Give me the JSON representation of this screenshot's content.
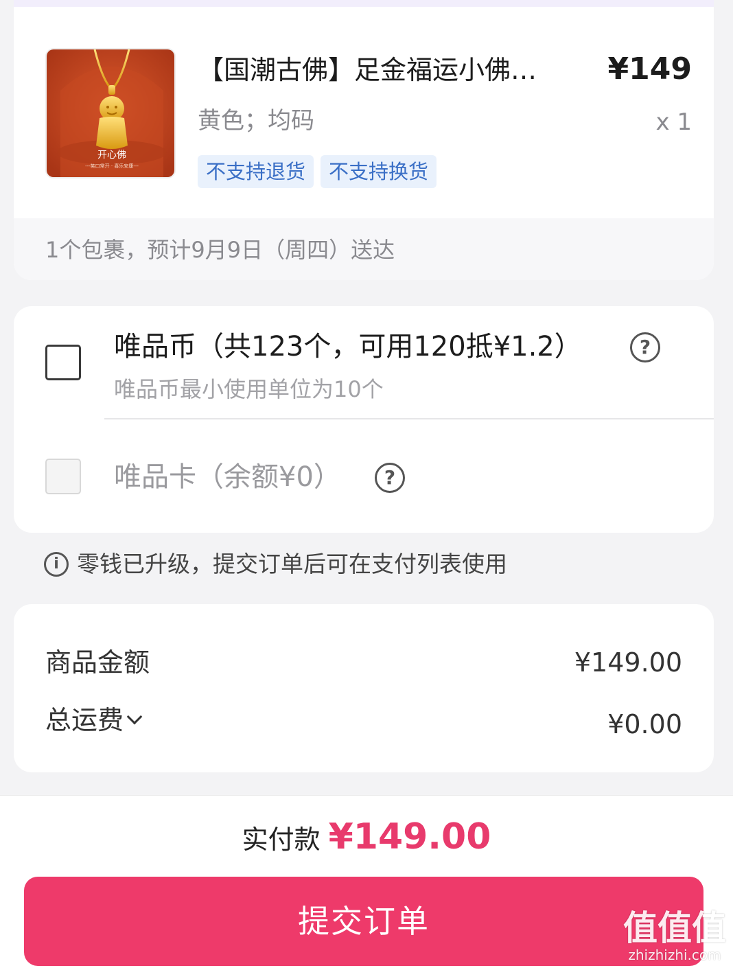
{
  "product": {
    "title": "【国潮古佛】足金福运小佛…",
    "price": "¥149",
    "spec": "黄色；均码",
    "quantity": "x 1",
    "tags": [
      "不支持退货",
      "不支持换货"
    ],
    "image_caption": "开心佛",
    "image_subcaption": "---笑口常开 · 喜乐安康---"
  },
  "delivery": {
    "text": "1个包裹，预计9月9日（周四）送达"
  },
  "options": {
    "vip_coin_title": "唯品币（共123个，可用120抵¥1.2）",
    "vip_coin_sub": "唯品币最小使用单位为10个",
    "vip_card_title": "唯品卡（余额¥0）"
  },
  "info": {
    "text": "零钱已升级，提交订单后可在支付列表使用"
  },
  "summary": {
    "goods_label": "商品金额",
    "goods_value": "¥149.00",
    "shipping_label": "总运费",
    "shipping_value": "¥0.00"
  },
  "footer": {
    "pay_label": "实付款",
    "pay_amount": "¥149.00",
    "submit_label": "提交订单"
  },
  "watermark": {
    "big": "值值值",
    "small": "zhizhizhi.com"
  },
  "colors": {
    "accent": "#ee3a6a",
    "tag_bg": "#e9f1fc",
    "tag_text": "#3a6fc6"
  }
}
